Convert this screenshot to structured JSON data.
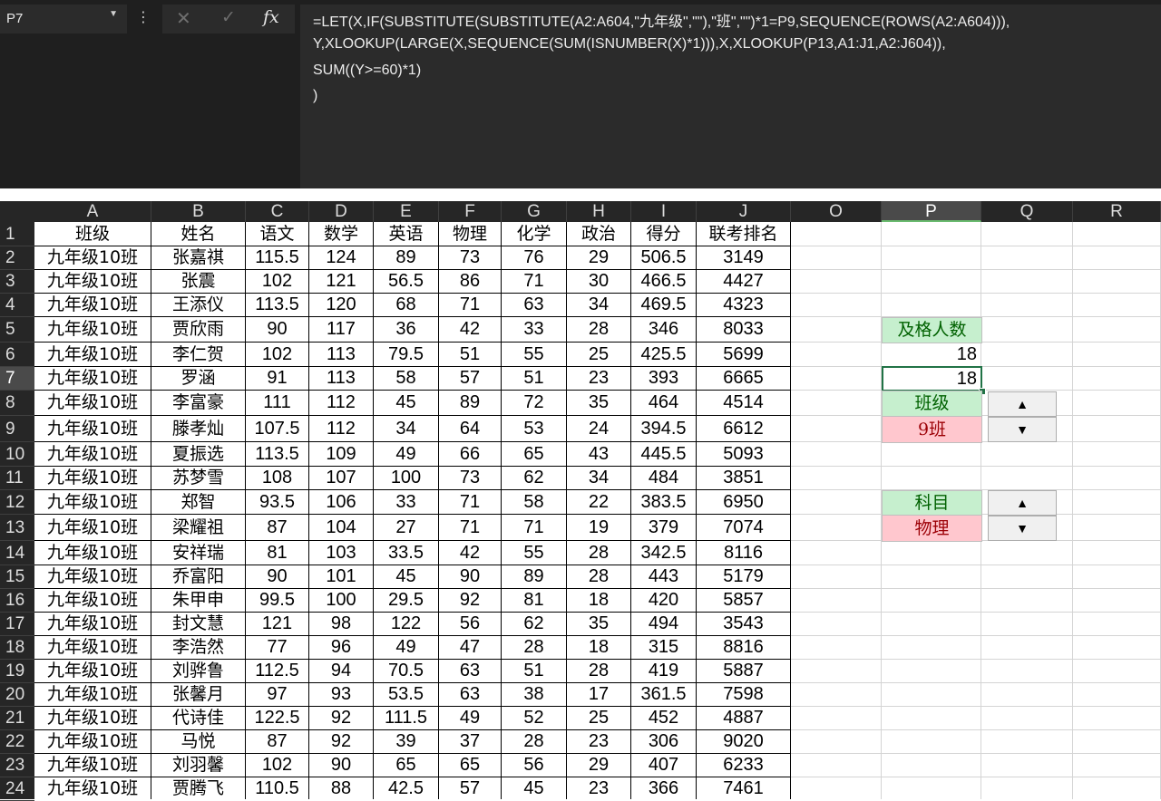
{
  "namebox": "P7",
  "formula_lines": [
    "=LET(X,IF(SUBSTITUTE(SUBSTITUTE(A2:A604,\"九年级\",\"\"),\"班\",\"\")*1=P9,SEQUENCE(ROWS(A2:A604))),",
    "Y,XLOOKUP(LARGE(X,SEQUENCE(SUM(ISNUMBER(X)*1))),X,XLOOKUP(P13,A1:J1,A2:J604)),",
    "SUM((Y>=60)*1)",
    ")"
  ],
  "columns": [
    "A",
    "B",
    "C",
    "D",
    "E",
    "F",
    "G",
    "H",
    "I",
    "J",
    "O",
    "P",
    "Q",
    "R"
  ],
  "rows": [
    "1",
    "2",
    "3",
    "4",
    "5",
    "6",
    "7",
    "8",
    "9",
    "10",
    "11",
    "12",
    "13",
    "14",
    "15",
    "16",
    "17",
    "18",
    "19",
    "20",
    "21",
    "22",
    "23",
    "24"
  ],
  "headers": [
    "班级",
    "姓名",
    "语文",
    "数学",
    "英语",
    "物理",
    "化学",
    "政治",
    "得分",
    "联考排名"
  ],
  "data": [
    [
      "九年级10班",
      "张嘉祺",
      "115.5",
      "124",
      "89",
      "73",
      "76",
      "29",
      "506.5",
      "3149"
    ],
    [
      "九年级10班",
      "张震",
      "102",
      "121",
      "56.5",
      "86",
      "71",
      "30",
      "466.5",
      "4427"
    ],
    [
      "九年级10班",
      "王添仪",
      "113.5",
      "120",
      "68",
      "71",
      "63",
      "34",
      "469.5",
      "4323"
    ],
    [
      "九年级10班",
      "贾欣雨",
      "90",
      "117",
      "36",
      "42",
      "33",
      "28",
      "346",
      "8033"
    ],
    [
      "九年级10班",
      "李仁贺",
      "102",
      "113",
      "79.5",
      "51",
      "55",
      "25",
      "425.5",
      "5699"
    ],
    [
      "九年级10班",
      "罗涵",
      "91",
      "113",
      "58",
      "57",
      "51",
      "23",
      "393",
      "6665"
    ],
    [
      "九年级10班",
      "李富豪",
      "111",
      "112",
      "45",
      "89",
      "72",
      "35",
      "464",
      "4514"
    ],
    [
      "九年级10班",
      "滕孝灿",
      "107.5",
      "112",
      "34",
      "64",
      "53",
      "24",
      "394.5",
      "6612"
    ],
    [
      "九年级10班",
      "夏振选",
      "113.5",
      "109",
      "49",
      "66",
      "65",
      "43",
      "445.5",
      "5093"
    ],
    [
      "九年级10班",
      "苏梦雪",
      "108",
      "107",
      "100",
      "73",
      "62",
      "34",
      "484",
      "3851"
    ],
    [
      "九年级10班",
      "郑智",
      "93.5",
      "106",
      "33",
      "71",
      "58",
      "22",
      "383.5",
      "6950"
    ],
    [
      "九年级10班",
      "梁耀祖",
      "87",
      "104",
      "27",
      "71",
      "71",
      "19",
      "379",
      "7074"
    ],
    [
      "九年级10班",
      "安祥瑞",
      "81",
      "103",
      "33.5",
      "42",
      "55",
      "28",
      "342.5",
      "8116"
    ],
    [
      "九年级10班",
      "乔富阳",
      "90",
      "101",
      "45",
      "90",
      "89",
      "28",
      "443",
      "5179"
    ],
    [
      "九年级10班",
      "朱甲申",
      "99.5",
      "100",
      "29.5",
      "92",
      "81",
      "18",
      "420",
      "5857"
    ],
    [
      "九年级10班",
      "封文慧",
      "121",
      "98",
      "122",
      "56",
      "62",
      "35",
      "494",
      "3543"
    ],
    [
      "九年级10班",
      "李浩然",
      "77",
      "96",
      "49",
      "47",
      "28",
      "18",
      "315",
      "8816"
    ],
    [
      "九年级10班",
      "刘骅鲁",
      "112.5",
      "94",
      "70.5",
      "63",
      "51",
      "28",
      "419",
      "5887"
    ],
    [
      "九年级10班",
      "张馨月",
      "97",
      "93",
      "53.5",
      "63",
      "38",
      "17",
      "361.5",
      "7598"
    ],
    [
      "九年级10班",
      "代诗佳",
      "122.5",
      "92",
      "111.5",
      "49",
      "52",
      "25",
      "452",
      "4887"
    ],
    [
      "九年级10班",
      "马悦",
      "87",
      "92",
      "39",
      "37",
      "28",
      "23",
      "306",
      "9020"
    ],
    [
      "九年级10班",
      "刘羽馨",
      "102",
      "90",
      "65",
      "65",
      "56",
      "29",
      "407",
      "6233"
    ],
    [
      "九年级10班",
      "贾腾飞",
      "110.5",
      "88",
      "42.5",
      "57",
      "45",
      "23",
      "366",
      "7461"
    ]
  ],
  "panel": {
    "pass_label": "及格人数",
    "pass_value_1": "18",
    "pass_value_2": "18",
    "class_label": "班级",
    "class_value": "9班",
    "subject_label": "科目",
    "subject_value": "物理",
    "spin_up": "▲",
    "spin_down": "▼"
  },
  "icons": {
    "cancel": "✕",
    "enter": "✓",
    "fx": "fx",
    "dropdown": "▼",
    "more": "⋮"
  }
}
